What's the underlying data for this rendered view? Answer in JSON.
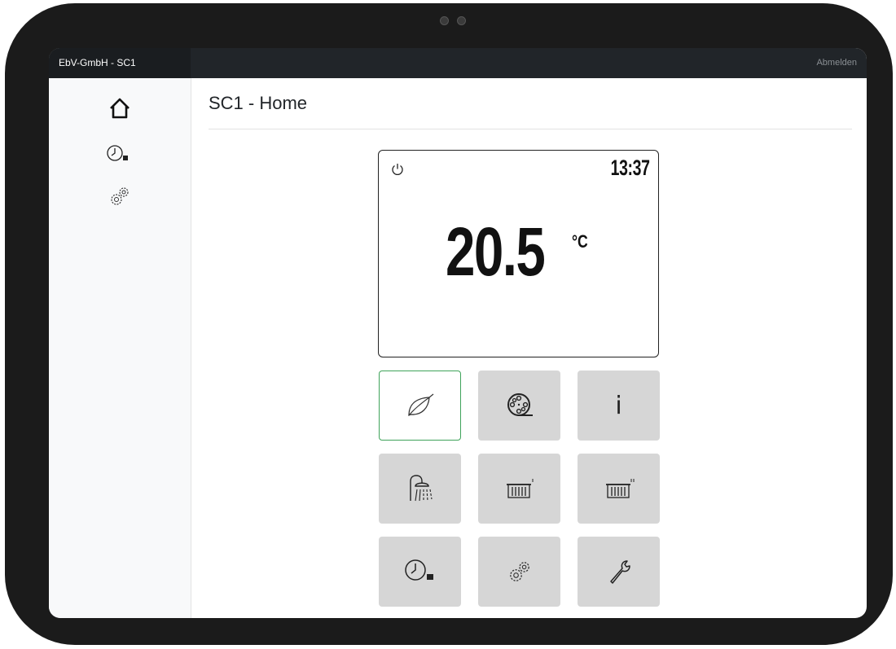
{
  "app": {
    "brand": "EbV-GmbH - SC1",
    "logout_label": "Abmelden"
  },
  "page": {
    "title": "SC1 - Home"
  },
  "thermostat": {
    "time": "13:37",
    "temperature": "20.5",
    "unit": "°C",
    "power_icon": "power-icon"
  },
  "sidebar": {
    "items": [
      {
        "icon": "home-icon"
      },
      {
        "icon": "schedule-clock-icon"
      },
      {
        "icon": "settings-gears-icon"
      }
    ]
  },
  "tiles": [
    {
      "icon": "eco-leaf-icon",
      "active": true
    },
    {
      "icon": "film-reel-icon"
    },
    {
      "icon": "info-icon",
      "glyph": "i"
    },
    {
      "icon": "shower-icon"
    },
    {
      "icon": "radiator-1-icon"
    },
    {
      "icon": "radiator-2-icon"
    },
    {
      "icon": "schedule-clock-icon"
    },
    {
      "icon": "settings-gears-icon"
    },
    {
      "icon": "wrench-icon"
    }
  ],
  "colors": {
    "topbar": "#212529",
    "tile": "#d6d6d6",
    "active_border": "#3fa35a",
    "bezel": "#1b1b1b"
  }
}
